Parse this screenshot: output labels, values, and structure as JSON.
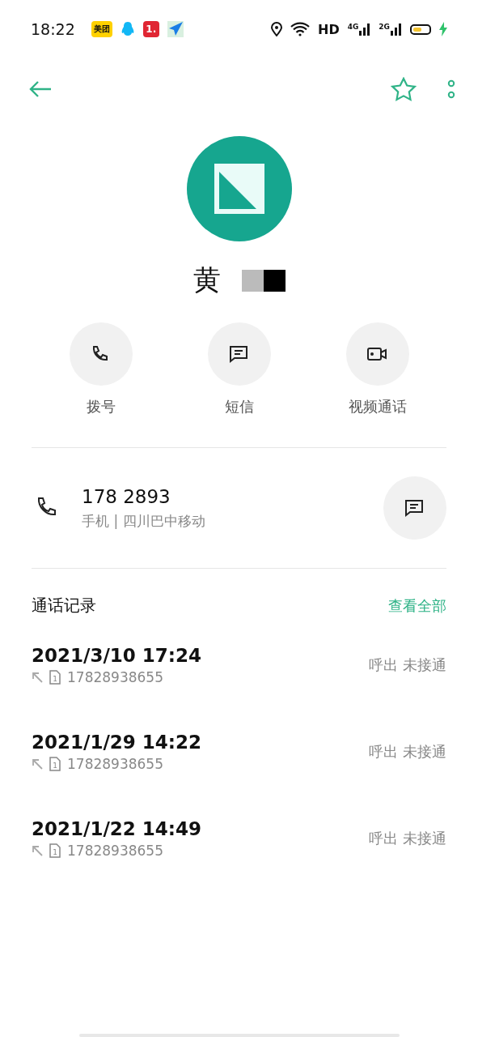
{
  "status_bar": {
    "time": "18:22",
    "app_icons": [
      {
        "kind": "meituan",
        "label": "美团"
      },
      {
        "kind": "qq"
      },
      {
        "kind": "one",
        "label": "1."
      },
      {
        "kind": "plane"
      }
    ],
    "hd": "HD",
    "networks": [
      {
        "label": "4G"
      },
      {
        "label": "2G"
      }
    ],
    "battery": {
      "charging": true
    }
  },
  "toolbar": {
    "favorite": false
  },
  "contact": {
    "name": "黄",
    "actions": [
      {
        "kind": "call",
        "label": "拨号"
      },
      {
        "kind": "message",
        "label": "短信"
      },
      {
        "kind": "video",
        "label": "视频通话"
      }
    ]
  },
  "phone": {
    "number": "178 2893",
    "detail": "手机 | 四川巴中移动"
  },
  "call_log": {
    "title": "通话记录",
    "view_all": "查看全部",
    "entries": [
      {
        "datetime": "2021/3/10 17:24",
        "sim": "1",
        "number": "17828938655",
        "status": "呼出 未接通"
      },
      {
        "datetime": "2021/1/29 14:22",
        "sim": "1",
        "number": "17828938655",
        "status": "呼出 未接通"
      },
      {
        "datetime": "2021/1/22 14:49",
        "sim": "1",
        "number": "17828938655",
        "status": "呼出 未接通"
      }
    ]
  }
}
